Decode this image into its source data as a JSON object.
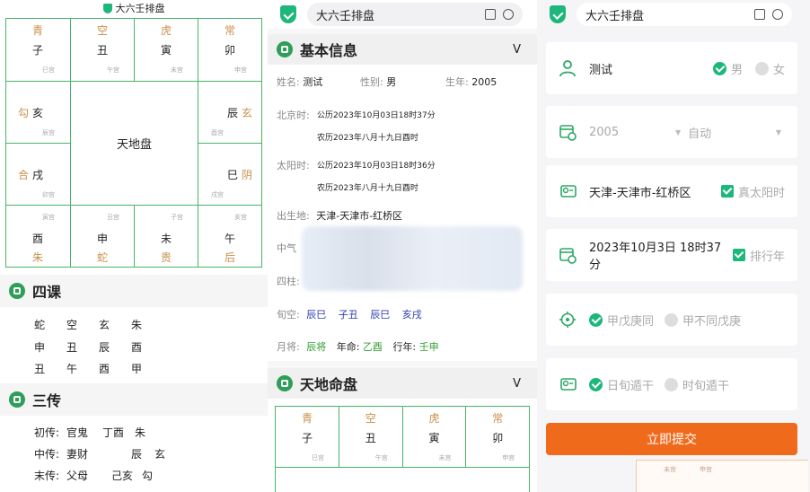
{
  "p1": {
    "title": "大六壬排盘",
    "grid": {
      "top": [
        {
          "god": "青",
          "branch": "子",
          "palace": "巳宫"
        },
        {
          "god": "空",
          "branch": "丑",
          "palace": "午宫"
        },
        {
          "god": "虎",
          "branch": "寅",
          "palace": "未宫"
        },
        {
          "god": "常",
          "branch": "卯",
          "palace": "申宫"
        }
      ],
      "left": [
        {
          "god": "勾",
          "branch": "亥",
          "palace": "辰宫"
        },
        {
          "god": "合",
          "branch": "戌",
          "palace": "卯宫"
        }
      ],
      "right": [
        {
          "god": "玄",
          "branch": "辰",
          "palace": "酉宫"
        },
        {
          "god": "阴",
          "branch": "巳",
          "palace": "戌宫"
        }
      ],
      "bottom": [
        {
          "god": "朱",
          "branch": "酉",
          "palace": "寅宫"
        },
        {
          "god": "蛇",
          "branch": "申",
          "palace": "丑宫"
        },
        {
          "god": "贵",
          "branch": "未",
          "palace": "子宫"
        },
        {
          "god": "后",
          "branch": "午",
          "palace": "亥宫"
        }
      ],
      "center": "天地盘"
    },
    "sike": {
      "title": "四课",
      "rows": [
        [
          "蛇",
          "空",
          "玄",
          "朱"
        ],
        [
          "申",
          "丑",
          "辰",
          "酉"
        ],
        [
          "丑",
          "午",
          "酉",
          "甲"
        ]
      ]
    },
    "sanchuan": {
      "title": "三传",
      "rows": [
        {
          "label": "初传:",
          "rel": "官鬼",
          "gz": "丁酉",
          "god": "朱"
        },
        {
          "label": "中传:",
          "rel": "妻财",
          "gz": "辰",
          "god": "玄"
        },
        {
          "label": "末传:",
          "rel": "父母",
          "gz": "己亥",
          "god": "勾"
        }
      ]
    }
  },
  "p2": {
    "addr": "大六壬排盘",
    "basic_title": "基本信息",
    "chevron": "V",
    "name_label": "姓名:",
    "name": "测试",
    "sex_label": "性别:",
    "sex": "男",
    "year_label": "生年:",
    "year": "2005",
    "beijing_label": "北京时:",
    "beijing_solar": "公历2023年10月03日18时37分",
    "beijing_lunar": "农历2023年八月十九日酉时",
    "solar_label": "太阳时:",
    "solar_solar": "公历2023年10月03日18时36分",
    "solar_lunar": "农历2023年八月十九日酉时",
    "place_label": "出生地:",
    "place": "天津-天津市-红桥区",
    "zhongqi_label": "中气",
    "sizhu_label": "四柱:",
    "xunkong_label": "旬空:",
    "xunkong": [
      "辰巳",
      "子丑",
      "辰巳",
      "亥戌"
    ],
    "yuejiang_label": "月将:",
    "yuejiang": "辰将",
    "ming_label": "年命:",
    "ming": "乙酉",
    "xing_label": "行年:",
    "xing": "壬申",
    "mingpan_title": "天地命盘",
    "mini": [
      {
        "god": "青",
        "branch": "子",
        "palace": "巳宫"
      },
      {
        "god": "空",
        "branch": "丑",
        "palace": "午宫"
      },
      {
        "god": "虎",
        "branch": "寅",
        "palace": "未宫"
      },
      {
        "god": "常",
        "branch": "卯",
        "palace": "申宫"
      }
    ]
  },
  "p3": {
    "addr": "大六壬排盘",
    "name": "测试",
    "male": "男",
    "female": "女",
    "year": "2005",
    "auto": "自动",
    "place": "天津-天津市-红桥区",
    "true_solar": "真太阳时",
    "datetime": "2023年10月3日 18时37分",
    "pai_xing_nian": "排行年",
    "jiawu_same": "甲戊庚同",
    "jiawu_diff": "甲不同戊庚",
    "ri_xun": "日旬遁干",
    "shi_xun": "时旬遁干",
    "submit": "立即提交",
    "peek": [
      "未宫",
      "申宫"
    ]
  }
}
